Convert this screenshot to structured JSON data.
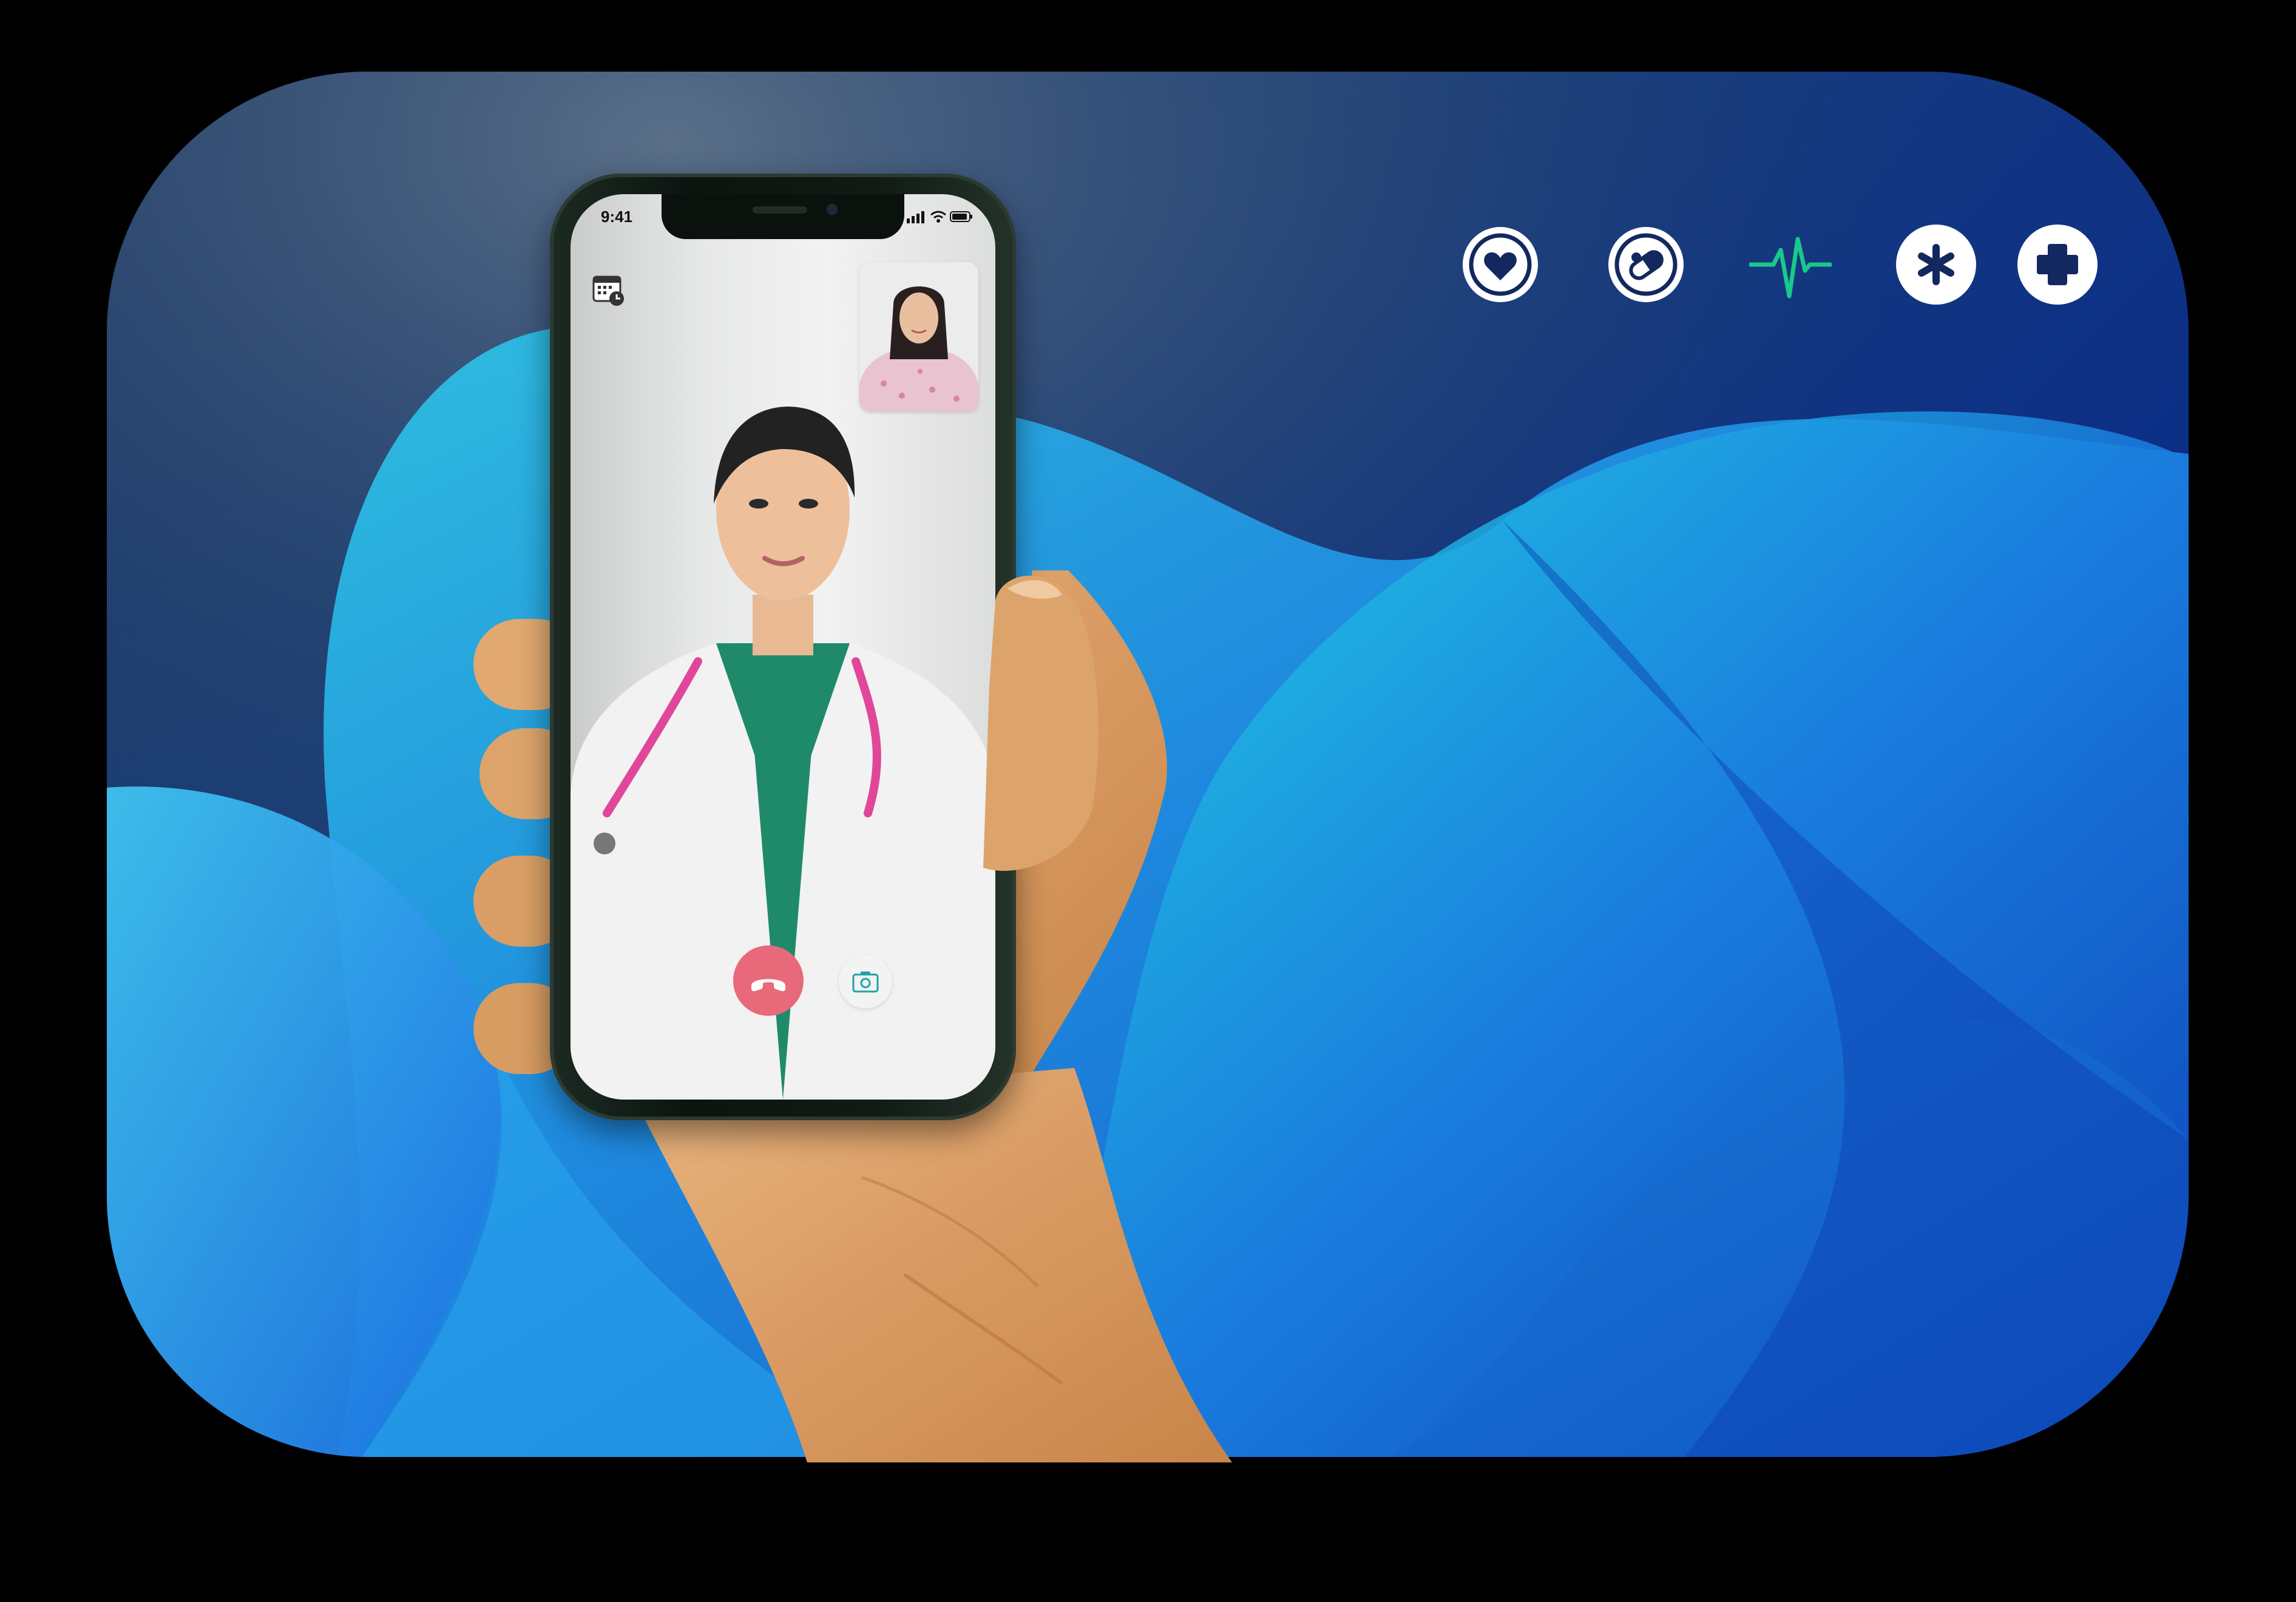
{
  "status_bar": {
    "time": "9:41"
  },
  "header_icons": [
    {
      "icon": "heart-icon"
    },
    {
      "icon": "pill-icon"
    },
    {
      "icon": "heartbeat-icon"
    },
    {
      "icon": "asterisk-icon"
    },
    {
      "icon": "medical-cross-icon"
    }
  ],
  "video_call": {
    "remote_participant": "doctor",
    "self_view": "patient",
    "controls": {
      "end_call_icon": "phone-hangup-icon",
      "switch_camera_icon": "camera-switch-icon",
      "schedule_icon": "calendar-clock-icon"
    }
  },
  "colors": {
    "background_dark": "#1d3a66",
    "wave_light": "#27c9e6",
    "wave_blue": "#1f6fe0",
    "heartbeat": "#19c88a",
    "end_call": "#e8697a",
    "icon_navy": "#13285e"
  }
}
